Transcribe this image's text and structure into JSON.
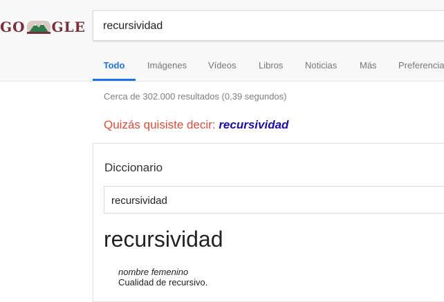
{
  "logo": {
    "left_text": "GO",
    "right_text": "GLE",
    "icon": "mountain-doodle-icon"
  },
  "search": {
    "query": "recursividad"
  },
  "tabs": [
    {
      "label": "Todo",
      "active": true
    },
    {
      "label": "Imágenes"
    },
    {
      "label": "Vídeos"
    },
    {
      "label": "Libros"
    },
    {
      "label": "Noticias"
    },
    {
      "label": "Más"
    },
    {
      "label": "Preferencias"
    }
  ],
  "results": {
    "stats": "Cerca de 302.000 resultados (0,39 segundos)",
    "did_you_mean_label": "Quizás quisiste decir:",
    "did_you_mean_term": "recursividad"
  },
  "dictionary": {
    "title": "Diccionario",
    "input_value": "recursividad",
    "headword": "recursividad",
    "part_of_speech": "nombre femenino",
    "definition": "Cualidad de recursivo."
  },
  "colors": {
    "accent_blue": "#1a73e8",
    "suggestion_red": "#dd4b39",
    "link_blue": "#1a0dab",
    "logo_maroon": "#7a2e3a"
  }
}
